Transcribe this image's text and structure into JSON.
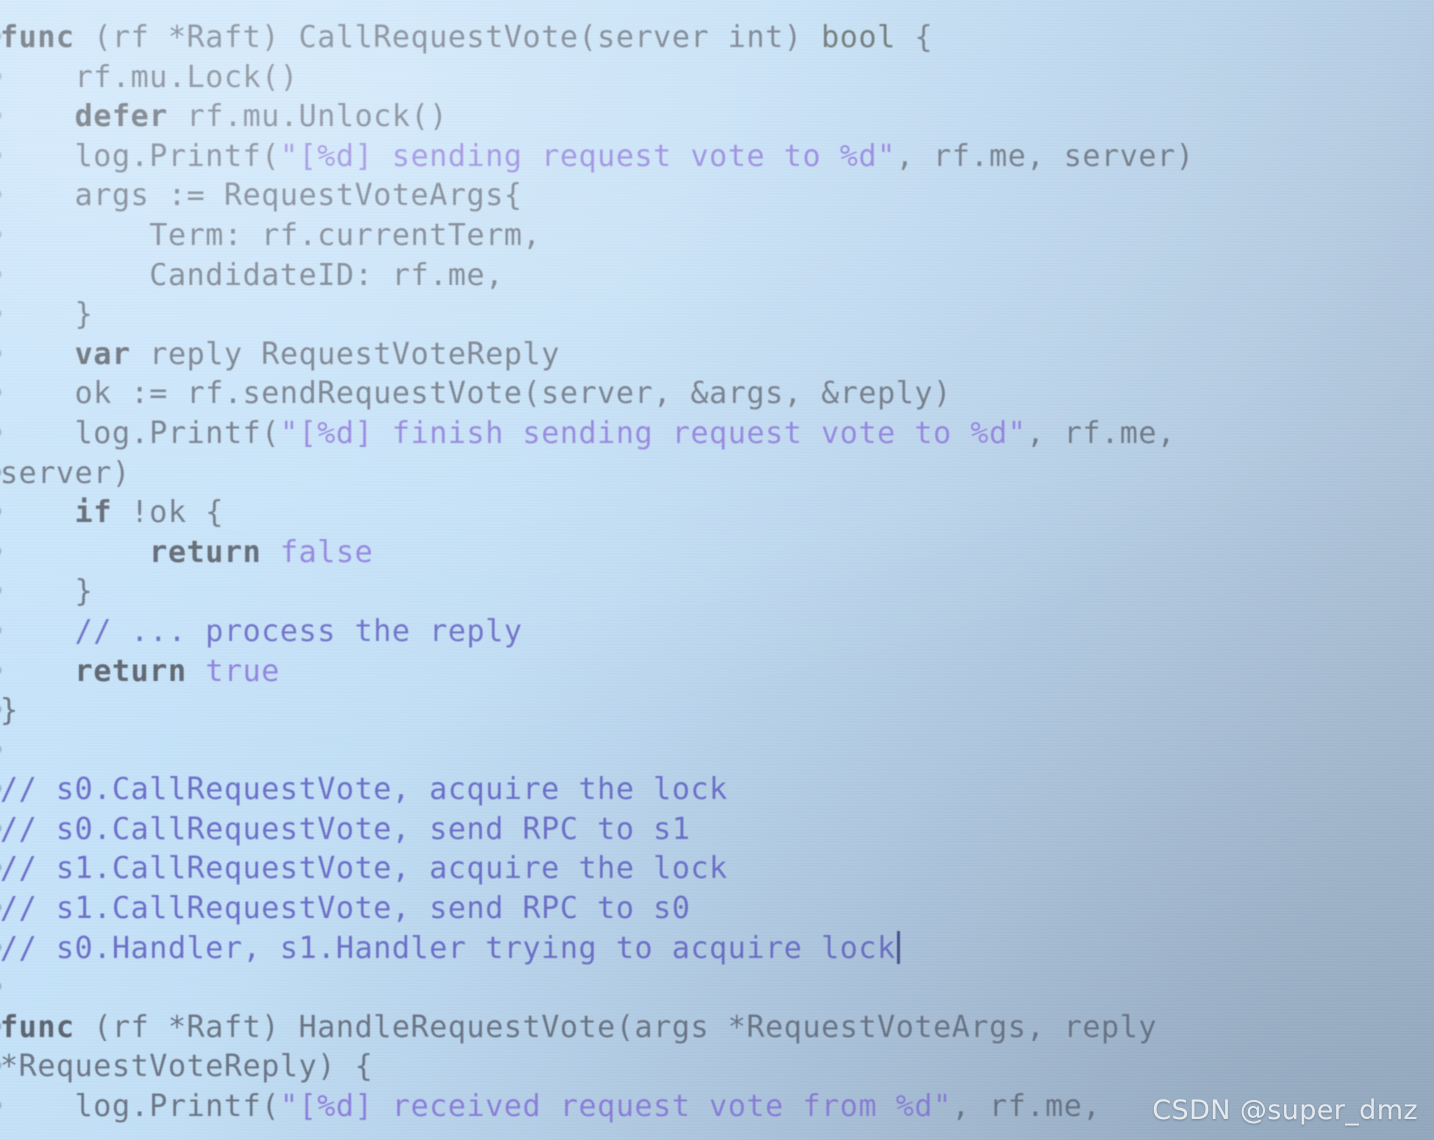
{
  "editor": {
    "language": "go",
    "background_top_left": "#c9e5fb",
    "background_bottom_right": "#a6bacd",
    "colors": {
      "keyword": "#5b6470",
      "type": "#5e6b6a",
      "plain": "#697585",
      "string": "#8b7fdd",
      "literal": "#8d81de",
      "comment": "#6a6fc9",
      "caret": "#46508f",
      "line_number": "#6e8296"
    },
    "gutter": {
      "visible_fragments": [
        "",
        "",
        "",
        "",
        "",
        "",
        "",
        "",
        "",
        "",
        "",
        "",
        "",
        "",
        "",
        "",
        "",
        "",
        "",
        "",
        "",
        "",
        "",
        "",
        "",
        "",
        "",
        ""
      ]
    },
    "caret_after_text": "// s0.Handler, s1.Handler trying to acquire lock"
  },
  "code": {
    "lines": [
      {
        "indent": 0,
        "tokens": [
          {
            "t": "func",
            "c": "kw"
          },
          {
            "t": " (rf *Raft) CallRequestVote(server int) ",
            "c": "pln"
          },
          {
            "t": "bool",
            "c": "typ"
          },
          {
            "t": " {",
            "c": "pln"
          }
        ]
      },
      {
        "indent": 0,
        "tokens": [
          {
            "t": "    rf.mu.Lock()",
            "c": "pln"
          }
        ]
      },
      {
        "indent": 0,
        "tokens": [
          {
            "t": "    ",
            "c": "pln"
          },
          {
            "t": "defer",
            "c": "kw"
          },
          {
            "t": " rf.mu.Unlock()",
            "c": "pln"
          }
        ]
      },
      {
        "indent": 0,
        "tokens": [
          {
            "t": "    log.Printf(",
            "c": "pln"
          },
          {
            "t": "\"[%d] sending request vote to %d\"",
            "c": "str"
          },
          {
            "t": ", rf.me, server)",
            "c": "pln"
          }
        ]
      },
      {
        "indent": 0,
        "tokens": [
          {
            "t": "    args := RequestVoteArgs{",
            "c": "pln"
          }
        ]
      },
      {
        "indent": 0,
        "tokens": [
          {
            "t": "        Term: rf.currentTerm,",
            "c": "pln"
          }
        ]
      },
      {
        "indent": 0,
        "tokens": [
          {
            "t": "        CandidateID: rf.me,",
            "c": "pln"
          }
        ]
      },
      {
        "indent": 0,
        "tokens": [
          {
            "t": "    }",
            "c": "pln"
          }
        ]
      },
      {
        "indent": 0,
        "tokens": [
          {
            "t": "    ",
            "c": "pln"
          },
          {
            "t": "var",
            "c": "kw"
          },
          {
            "t": " reply RequestVoteReply",
            "c": "pln"
          }
        ]
      },
      {
        "indent": 0,
        "tokens": [
          {
            "t": "    ok := rf.sendRequestVote(server, &args, &reply)",
            "c": "pln"
          }
        ]
      },
      {
        "indent": 0,
        "tokens": [
          {
            "t": "    log.Printf(",
            "c": "pln"
          },
          {
            "t": "\"[%d] finish sending request vote to %d\"",
            "c": "str"
          },
          {
            "t": ", rf.me,",
            "c": "pln"
          }
        ]
      },
      {
        "indent": 0,
        "tokens": [
          {
            "t": "server)",
            "c": "pln"
          }
        ]
      },
      {
        "indent": 0,
        "tokens": [
          {
            "t": "    ",
            "c": "pln"
          },
          {
            "t": "if",
            "c": "kw"
          },
          {
            "t": " !ok {",
            "c": "pln"
          }
        ]
      },
      {
        "indent": 0,
        "tokens": [
          {
            "t": "        ",
            "c": "pln"
          },
          {
            "t": "return",
            "c": "kw"
          },
          {
            "t": " ",
            "c": "pln"
          },
          {
            "t": "false",
            "c": "lit"
          }
        ]
      },
      {
        "indent": 0,
        "tokens": [
          {
            "t": "    }",
            "c": "pln"
          }
        ]
      },
      {
        "indent": 0,
        "tokens": [
          {
            "t": "    // ... process the reply",
            "c": "cmt"
          }
        ]
      },
      {
        "indent": 0,
        "tokens": [
          {
            "t": "    ",
            "c": "pln"
          },
          {
            "t": "return",
            "c": "kw"
          },
          {
            "t": " ",
            "c": "pln"
          },
          {
            "t": "true",
            "c": "lit"
          }
        ]
      },
      {
        "indent": 0,
        "tokens": [
          {
            "t": "}",
            "c": "pln"
          }
        ]
      },
      {
        "indent": 0,
        "tokens": []
      },
      {
        "indent": 0,
        "tokens": [
          {
            "t": "// s0.CallRequestVote, acquire the lock",
            "c": "cmt"
          }
        ]
      },
      {
        "indent": 0,
        "tokens": [
          {
            "t": "// s0.CallRequestVote, send RPC to s1",
            "c": "cmt"
          }
        ]
      },
      {
        "indent": 0,
        "tokens": [
          {
            "t": "// s1.CallRequestVote, acquire the lock",
            "c": "cmt"
          }
        ]
      },
      {
        "indent": 0,
        "tokens": [
          {
            "t": "// s1.CallRequestVote, send RPC to s0",
            "c": "cmt"
          }
        ]
      },
      {
        "indent": 0,
        "tokens": [
          {
            "t": "// s0.Handler, s1.Handler trying to acquire lock",
            "c": "cmt"
          },
          {
            "t": "",
            "c": "caret"
          }
        ]
      },
      {
        "indent": 0,
        "tokens": []
      },
      {
        "indent": 0,
        "tokens": [
          {
            "t": "func",
            "c": "kw"
          },
          {
            "t": " (rf *Raft) HandleRequestVote(args *RequestVoteArgs, reply",
            "c": "pln"
          }
        ]
      },
      {
        "indent": 0,
        "tokens": [
          {
            "t": "*RequestVoteReply) {",
            "c": "pln"
          }
        ]
      },
      {
        "indent": 0,
        "tokens": [
          {
            "t": "    log.Printf(",
            "c": "pln"
          },
          {
            "t": "\"[%d] received request vote from %d\"",
            "c": "str"
          },
          {
            "t": ", rf.me,",
            "c": "pln"
          }
        ]
      }
    ]
  },
  "watermark": {
    "text": "CSDN @super_dmz"
  }
}
